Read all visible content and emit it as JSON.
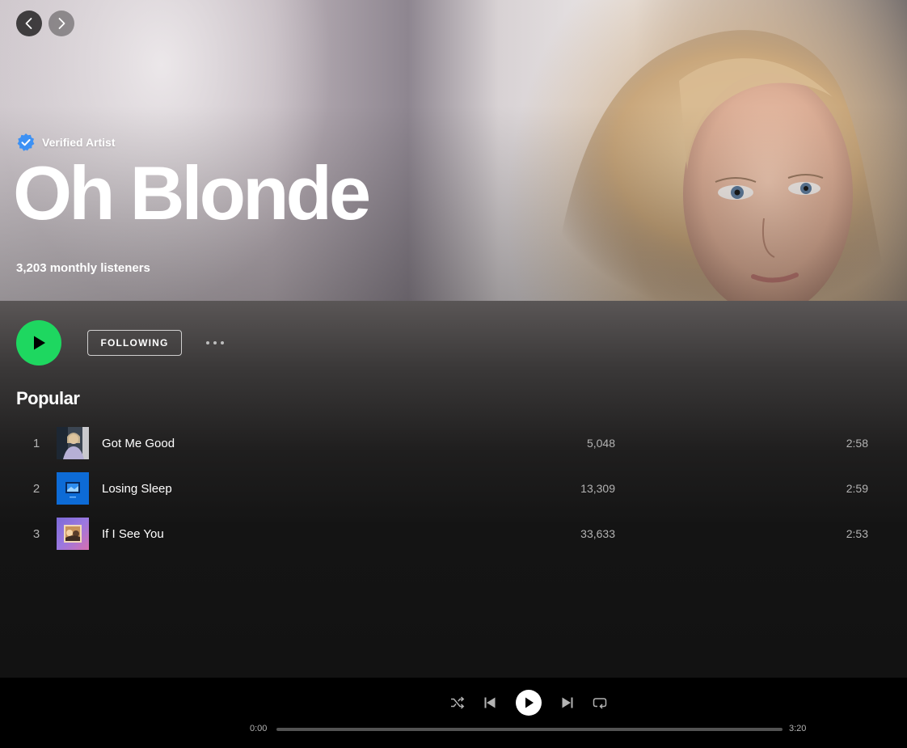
{
  "artist": {
    "verified_label": "Verified Artist",
    "name": "Oh Blonde",
    "monthly_listeners": "3,203 monthly listeners"
  },
  "actions": {
    "follow_label": "FOLLOWING"
  },
  "popular": {
    "title": "Popular",
    "tracks": [
      {
        "number": "1",
        "title": "Got Me Good",
        "plays": "5,048",
        "duration": "2:58"
      },
      {
        "number": "2",
        "title": "Losing Sleep",
        "plays": "13,309",
        "duration": "2:59"
      },
      {
        "number": "3",
        "title": "If I See You",
        "plays": "33,633",
        "duration": "2:53"
      }
    ]
  },
  "player": {
    "current_time": "0:00",
    "total_time": "3:20",
    "progress": 0
  },
  "colors": {
    "accent": "#1ed760",
    "verified_badge": "#3d91f4",
    "background": "#121212"
  },
  "icons": [
    "back-arrow-icon",
    "forward-arrow-icon",
    "verified-badge-icon",
    "play-icon",
    "more-icon",
    "shuffle-icon",
    "previous-icon",
    "next-icon",
    "repeat-icon"
  ]
}
